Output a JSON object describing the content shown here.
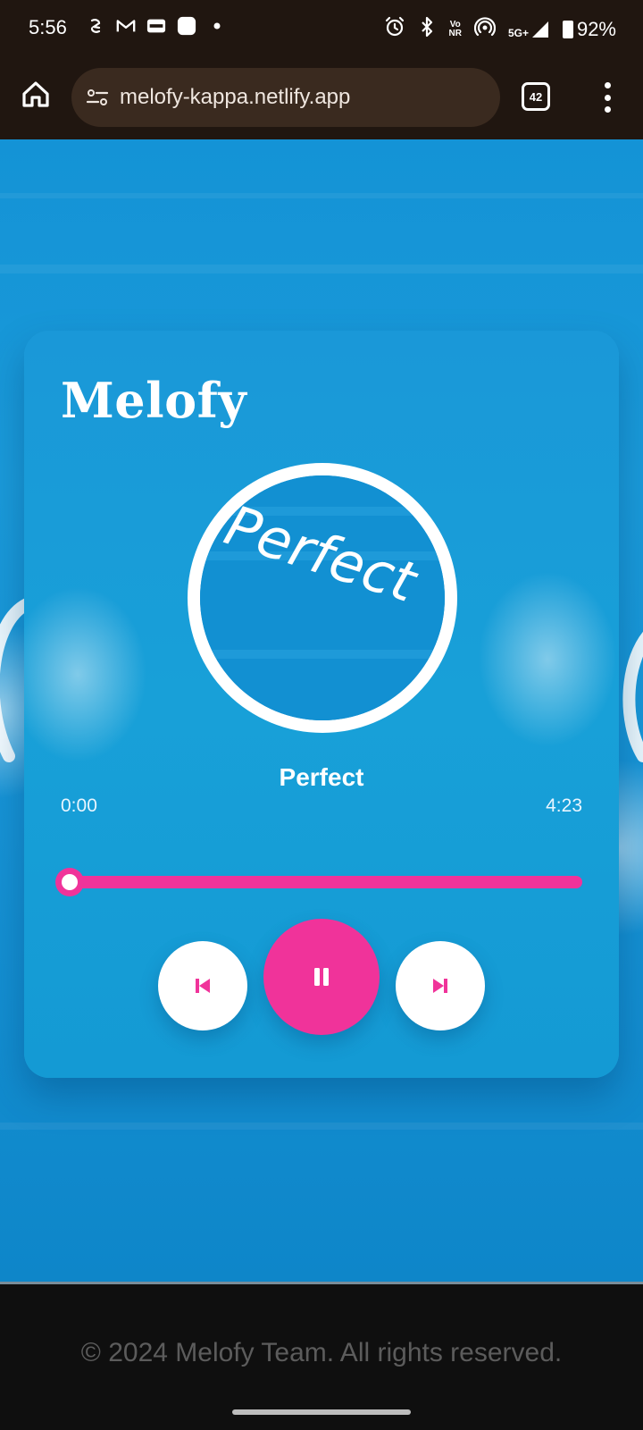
{
  "status_bar": {
    "time": "5:56",
    "network": "5G+",
    "volte_top": "Vo",
    "volte_bottom": "NR",
    "battery": "92%"
  },
  "browser": {
    "url": "melofy-kappa.netlify.app",
    "tab_count": "42"
  },
  "player": {
    "app_title": "Melofy",
    "cover_text": "Perfect",
    "song_title": "Perfect",
    "current_time": "0:00",
    "total_time": "4:23",
    "progress_fraction": 0.0,
    "accent_color": "#f0339a"
  },
  "footer": {
    "text": "© 2024 Melofy Team. All rights reserved."
  }
}
